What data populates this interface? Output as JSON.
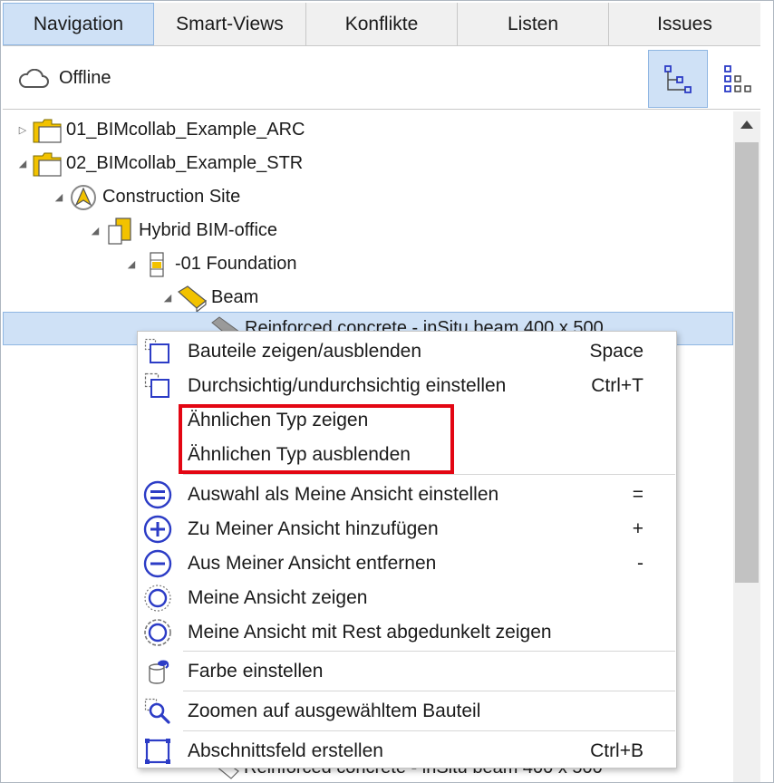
{
  "tabs": [
    {
      "label": "Navigation",
      "active": true
    },
    {
      "label": "Smart-Views",
      "active": false
    },
    {
      "label": "Konflikte",
      "active": false
    },
    {
      "label": "Listen",
      "active": false
    },
    {
      "label": "Issues",
      "active": false
    }
  ],
  "status": {
    "label": "Offline",
    "icon": "cloud-icon"
  },
  "view_buttons": [
    {
      "name": "tree-view-icon",
      "active": true
    },
    {
      "name": "list-view-icon",
      "active": false
    }
  ],
  "tree": {
    "items": [
      {
        "label": "01_BIMcollab_Example_ARC",
        "expanded": false,
        "icon": "folder-icon"
      },
      {
        "label": "02_BIMcollab_Example_STR",
        "expanded": true,
        "icon": "folder-icon"
      },
      {
        "label": "Construction Site",
        "expanded": true,
        "icon": "site-icon"
      },
      {
        "label": "Hybrid BIM-office",
        "expanded": true,
        "icon": "building-icon"
      },
      {
        "label": "-01 Foundation",
        "expanded": true,
        "icon": "storey-icon"
      },
      {
        "label": "Beam",
        "expanded": true,
        "icon": "beam-type-icon"
      },
      {
        "label": "Reinforced concrete - inSitu beam 400 x 500",
        "selected": true,
        "icon": "beam-icon"
      },
      {
        "label": "Reinforced concrete - inSitu beam 400 x 500",
        "selected": false,
        "icon": "beam-icon"
      }
    ]
  },
  "menu": {
    "items": [
      {
        "label": "Bauteile zeigen/ausblenden",
        "shortcut": "Space",
        "icon": "show-hide-icon"
      },
      {
        "label": "Durchsichtig/undurchsichtig einstellen",
        "shortcut": "Ctrl+T",
        "icon": "transparency-icon"
      },
      {
        "label": "Ähnlichen Typ zeigen",
        "shortcut": "",
        "icon": ""
      },
      {
        "label": "Ähnlichen Typ ausblenden",
        "shortcut": "",
        "icon": ""
      },
      {
        "label": "Auswahl als Meine Ansicht einstellen",
        "shortcut": "=",
        "icon": "equals-circle-icon"
      },
      {
        "label": "Zu Meiner Ansicht hinzufügen",
        "shortcut": "+",
        "icon": "plus-circle-icon"
      },
      {
        "label": "Aus Meiner Ansicht entfernen",
        "shortcut": "-",
        "icon": "minus-circle-icon"
      },
      {
        "label": "Meine Ansicht zeigen",
        "shortcut": "",
        "icon": "show-view-icon"
      },
      {
        "label": "Meine Ansicht mit Rest abgedunkelt zeigen",
        "shortcut": "",
        "icon": "dimmed-view-icon"
      },
      {
        "label": "Farbe einstellen",
        "shortcut": "",
        "icon": "paint-bucket-icon"
      },
      {
        "label": "Zoomen auf ausgewähltem Bauteil",
        "shortcut": "",
        "icon": "zoom-icon"
      },
      {
        "label": "Abschnittsfeld erstellen",
        "shortcut": "Ctrl+B",
        "icon": "section-box-icon"
      }
    ]
  },
  "colors": {
    "accent": "#cfe1f6",
    "accent_border": "#8fb6e2",
    "icon_blue": "#2c3cc6",
    "folder_yellow": "#f2c200",
    "highlight_red": "#e30613"
  }
}
